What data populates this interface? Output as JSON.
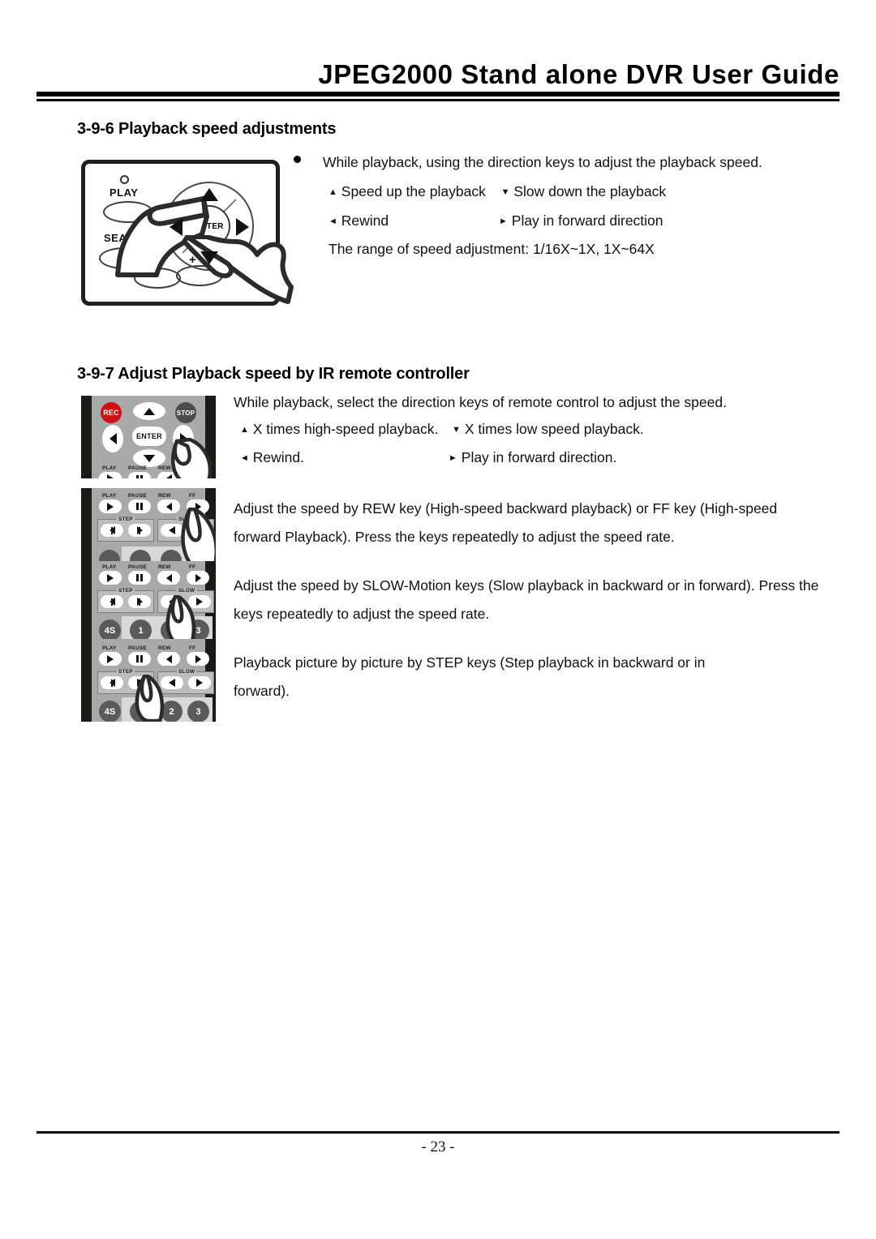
{
  "header": {
    "title": "JPEG2000 Stand alone DVR User Guide"
  },
  "footer": {
    "page_number": "- 23 -"
  },
  "sections": [
    {
      "id": "3-9-6",
      "heading": "3-9-6 Playback speed adjustments",
      "bullet_line": "While playback, using the direction keys to adjust the playback speed.",
      "key_lines": [
        {
          "up_arrow": "▲",
          "up_text": "Speed up the playback",
          "down_arrow": "▼",
          "down_text": "Slow down the playback"
        },
        {
          "left_arrow": "◄",
          "left_text": "Rewind",
          "right_arrow": "►",
          "right_text": "Play in forward direction"
        }
      ],
      "range_line": "The range of speed adjustment: 1/16X~1X, 1X~64X"
    },
    {
      "id": "3-9-7",
      "heading": "3-9-7 Adjust Playback speed by IR remote controller",
      "intro": "While playback, select the direction keys of remote control to adjust the speed.",
      "key_lines": [
        {
          "up_arrow": "▲",
          "up_text": "X times high-speed playback.",
          "down_arrow": "▼",
          "down_text": "X times low speed playback."
        },
        {
          "left_arrow": "◄",
          "left_text": "Rewind.",
          "right_arrow": "►",
          "right_text": "Play in forward direction."
        }
      ],
      "paragraphs": [
        "Adjust the speed by REW key (High-speed backward playback) or FF key (High-speed forward Playback). Press the keys repeatedly to adjust the speed rate.",
        "Adjust the speed by SLOW-Motion keys (Slow playback in backward or in forward). Press the keys repeatedly to adjust the speed rate.",
        "Playback picture by picture by STEP keys (Step playback in backward or in forward)."
      ]
    }
  ],
  "dvr_panel": {
    "led": "",
    "play_label": "PLAY",
    "search_label": "SEARCH",
    "enter_label": "ENTER",
    "plus_label": "+"
  },
  "remote": {
    "rec_label": "REC",
    "stop_label": "STOP",
    "enter_label": "ENTER",
    "transport_labels": [
      "PLAY",
      "PAUSE",
      "REW",
      "FF"
    ],
    "step_group_label": "STEP",
    "slow_group_label": "SLOW",
    "num_keys_3": [
      "4S",
      "1",
      "3"
    ],
    "num_keys_4": [
      "4S",
      "2",
      "3"
    ]
  },
  "colors": {
    "rec_red": "#cc1111",
    "stop_gray": "#4d4d4d",
    "body_gray": "#a9a9a9",
    "edge_black": "#1c1a19",
    "num_key_gray": "#5a5a5a"
  }
}
